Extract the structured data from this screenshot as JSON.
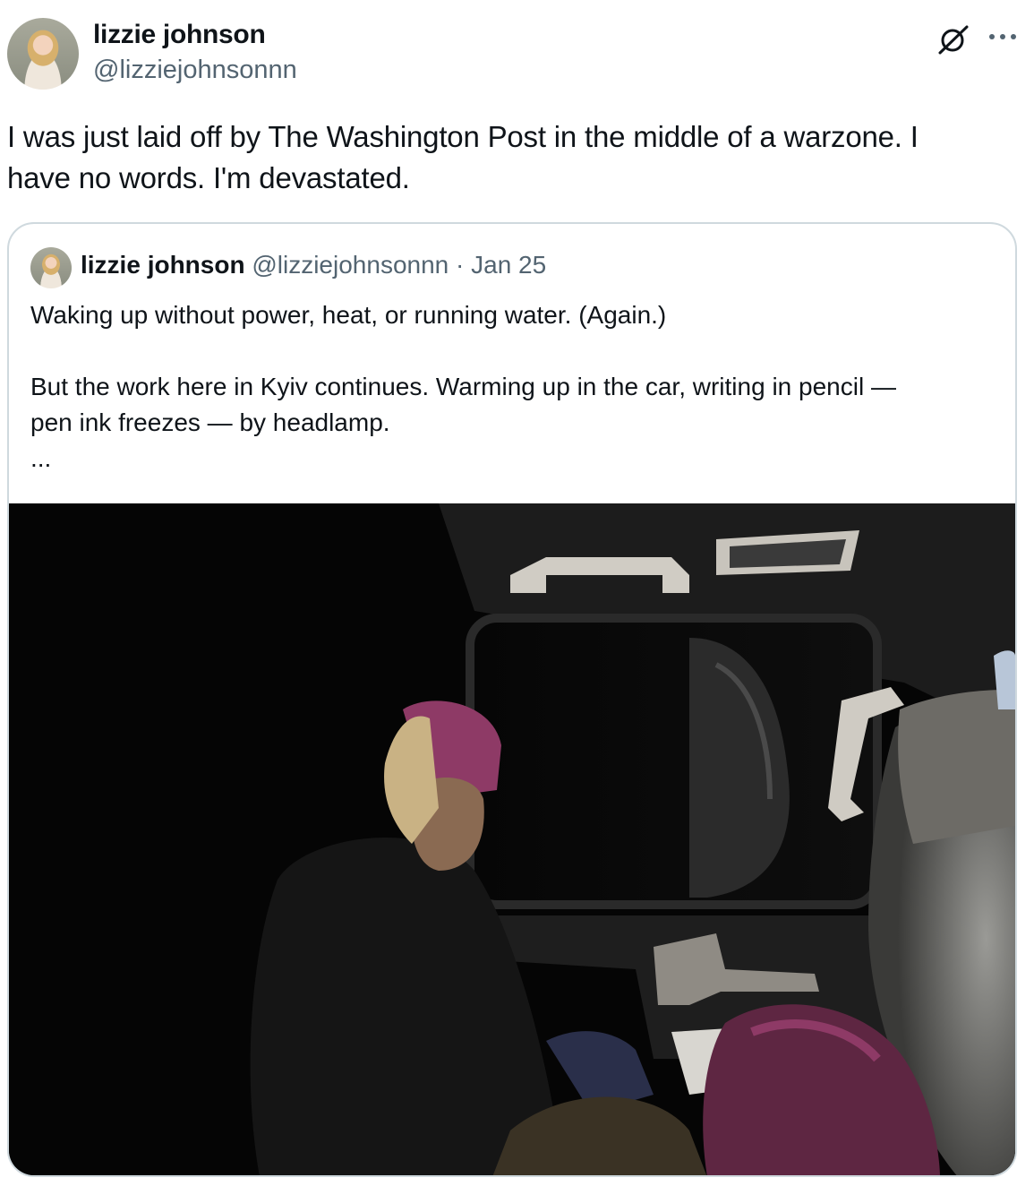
{
  "tweet": {
    "author_name": "lizzie johnson",
    "author_handle": "@lizziejohnsonnn",
    "text_line1": "I was just laid off by The Washington Post in the middle of a warzone. I",
    "text_line2": "have no words. I'm devastated."
  },
  "icons": {
    "grok": "grok-slash-circle-icon",
    "more": "more-options-icon"
  },
  "quoted": {
    "author_name": "lizzie johnson",
    "author_handle": "@lizziejohnsonnn",
    "separator": "·",
    "date": "Jan 25",
    "line1": "Waking up without power, heat, or running water. (Again.)",
    "line2": "But the work here in Kyiv continues. Warming up in the car, writing in pencil —",
    "line3": "pen ink freezes — by headlamp.",
    "line4": "..."
  },
  "colors": {
    "text_primary": "#0f1419",
    "text_secondary": "#536471",
    "border": "#cfd9de",
    "beanie": "#8e3a66"
  }
}
